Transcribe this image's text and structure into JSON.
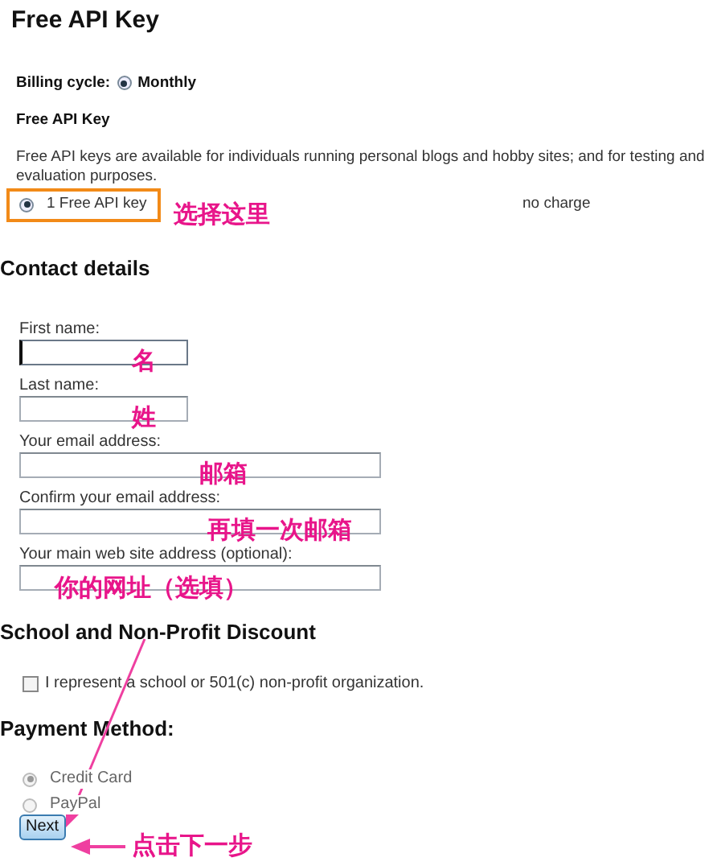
{
  "title": "Free API Key",
  "billing": {
    "label": "Billing cycle:",
    "option": "Monthly",
    "selected": true
  },
  "plan": {
    "heading": "Free API Key",
    "description": "Free API keys are available for individuals running personal blogs and hobby sites; and for testing and evaluation purposes.",
    "options": [
      {
        "label": "1 Free API key",
        "price": "no charge",
        "selected": true,
        "highlighted": true
      }
    ]
  },
  "contact": {
    "heading": "Contact details",
    "fields": [
      {
        "label": "First name:",
        "kind": "short",
        "focused": true
      },
      {
        "label": "Last name:",
        "kind": "short",
        "focused": false
      },
      {
        "label": "Your email address:",
        "kind": "long",
        "focused": false
      },
      {
        "label": "Confirm your email address:",
        "kind": "long",
        "focused": false
      },
      {
        "label": "Your main web site address (optional):",
        "kind": "long",
        "focused": false
      }
    ]
  },
  "discount": {
    "heading": "School and Non-Profit Discount",
    "checkbox": {
      "label": "I represent a school or 501(c) non-profit organization.",
      "checked": false
    }
  },
  "payment": {
    "heading": "Payment Method:",
    "options": [
      {
        "label": "Credit Card",
        "selected": true,
        "disabled": true
      },
      {
        "label": "PayPal",
        "selected": false,
        "disabled": true
      }
    ],
    "button": "Next"
  },
  "annotations": [
    {
      "text": "选择这里"
    },
    {
      "text": "名"
    },
    {
      "text": "姓"
    },
    {
      "text": "邮箱"
    },
    {
      "text": "再填一次邮箱"
    },
    {
      "text": "你的网址（选填）"
    },
    {
      "text": "点击下一步"
    }
  ]
}
